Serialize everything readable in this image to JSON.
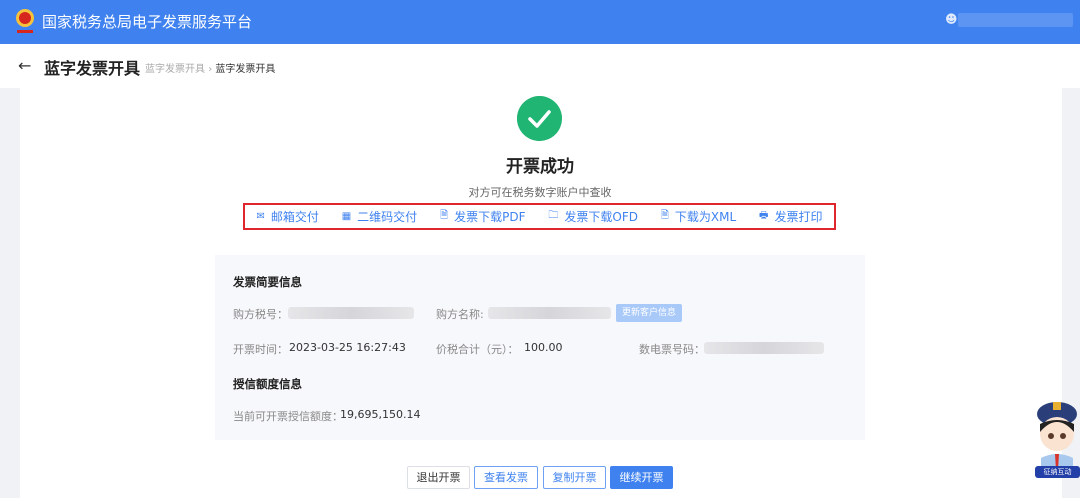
{
  "header": {
    "title": "国家税务总局电子发票服务平台",
    "user_icon": "user-icon"
  },
  "subheader": {
    "back": "←",
    "title": "蓝字发票开具",
    "breadcrumb": [
      "蓝字发票开具",
      "蓝字发票开具"
    ],
    "sep": "›"
  },
  "result": {
    "title": "开票成功",
    "desc": "对方可在税务数字账户中查收"
  },
  "actions": [
    {
      "icon": "✉",
      "label": "邮箱交付"
    },
    {
      "icon": "▦",
      "label": "二维码交付"
    },
    {
      "icon": "🗎",
      "label": "发票下载PDF"
    },
    {
      "icon": "🗀",
      "label": "发票下载OFD"
    },
    {
      "icon": "🗎",
      "label": "下载为XML"
    },
    {
      "icon": "🖶",
      "label": "发票打印"
    }
  ],
  "summary": {
    "heading": "发票简要信息",
    "buyer_tax_label": "购方税号：",
    "buyer_name_label": "购方名称:",
    "update_button": "更新客户信息",
    "time_label": "开票时间：",
    "time_value": "2023-03-25 16:27:43",
    "total_label": "价税合计（元）：",
    "total_value": "100.00",
    "number_label": "数电票号码："
  },
  "credit": {
    "heading": "授信额度信息",
    "label": "当前可开票授信额度：",
    "value": "19,695,150.14"
  },
  "buttons": {
    "exit": "退出开票",
    "view": "查看发票",
    "copy": "复制开票",
    "continue": "继续开票"
  },
  "mascot": {
    "label": "征纳互动"
  },
  "colors": {
    "primary": "#3f82ef",
    "success": "#21b573",
    "highlight": "#e0262d"
  }
}
